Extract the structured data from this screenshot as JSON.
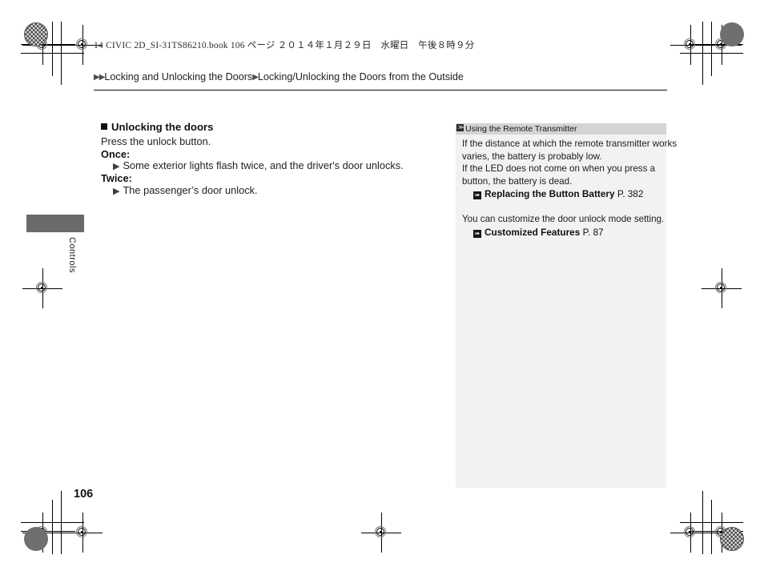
{
  "print_header": "14 CIVIC 2D_SI-31TS86210.book  106 ページ  ２０１４年１月２９日　水曜日　午後８時９分",
  "breadcrumb": {
    "marker": "▶▶",
    "level1": "Locking and Unlocking the Doors",
    "separator": "▶",
    "level2": "Locking/Unlocking the Doors from the Outside"
  },
  "main": {
    "section_heading": "Unlocking the doors",
    "intro": "Press the unlock button.",
    "items": [
      {
        "label": "Once:",
        "arrow": "▶",
        "text": "Some exterior lights flash twice, and the driver's door unlocks."
      },
      {
        "label": "Twice:",
        "arrow": "▶",
        "text": "The passenger’s door unlock."
      }
    ]
  },
  "chapter_tab": {
    "label": "Controls",
    "color": "#6a6a6a"
  },
  "page_number": "106",
  "info_panel": {
    "header_icon": "≫",
    "header_title": "Using the Remote Transmitter",
    "paragraph1": [
      "If the distance at which the remote transmitter works",
      "varies, the battery is probably low.",
      "If the LED does not come on when you press a",
      "button, the battery is dead."
    ],
    "reference1": {
      "icon": "➠",
      "title": "Replacing the Button Battery",
      "page": "P. 382"
    },
    "paragraph2": [
      "You can customize the door unlock mode setting."
    ],
    "reference2": {
      "icon": "➠",
      "title": "Customized Features",
      "page": "P. 87"
    },
    "background": "#f2f2f2",
    "header_background": "#d4d4d4"
  }
}
